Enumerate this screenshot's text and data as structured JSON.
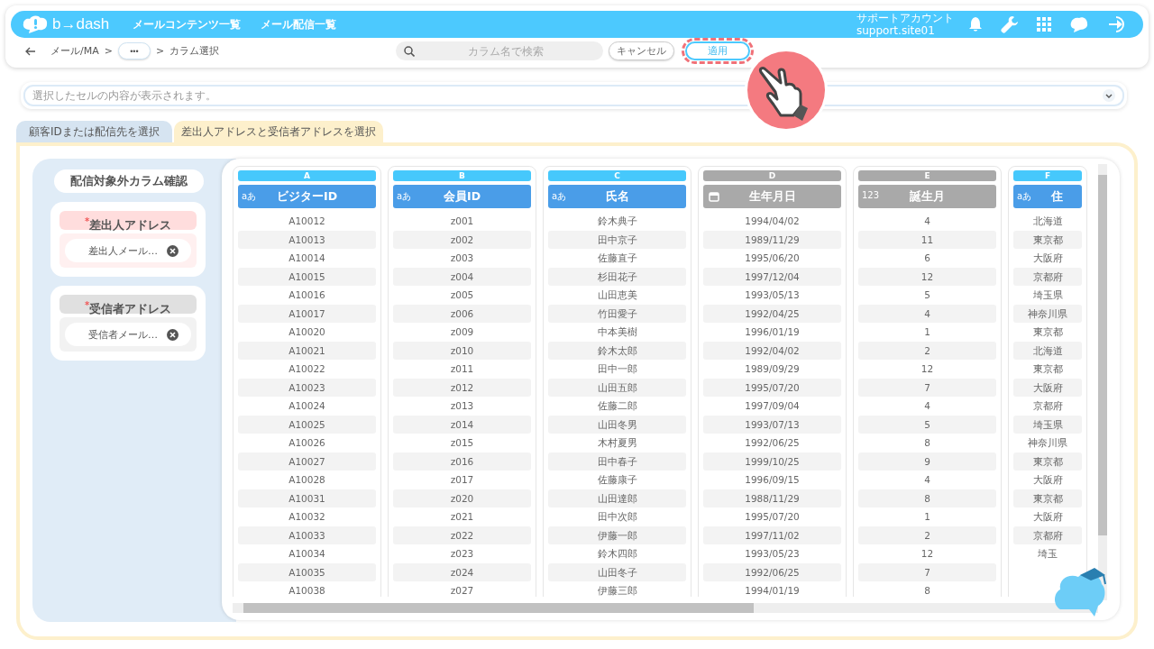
{
  "header": {
    "logo": "b→dash",
    "nav": [
      "メールコンテンツ一覧",
      "メール配信一覧"
    ],
    "account_name": "サポートアカウント",
    "account_id": "support.site01"
  },
  "breadcrumb": {
    "items": [
      "メール/MA",
      "カラム選択"
    ],
    "more": "•••",
    "separator": ">"
  },
  "search": {
    "placeholder": "カラム名で検索"
  },
  "buttons": [
    {
      "label": "キャンセル",
      "kind": "cancel",
      "highlighted": false
    },
    {
      "label": "適用",
      "kind": "apply",
      "highlighted": true
    }
  ],
  "cell_view": {
    "placeholder": "選択したセルの内容が表示されます。"
  },
  "tabs": [
    {
      "label": "顧客IDまたは配信先を選択",
      "selected": false
    },
    {
      "label": "差出人アドレスと受信者アドレスを選択",
      "selected": true
    }
  ],
  "sidebar": {
    "title": "配信対象外カラム確認",
    "groups": [
      {
        "label": "$^{*}$差出人アドレス",
        "active": true,
        "chip": "差出人メール…"
      },
      {
        "label": "$^{*}$受信者アドレス",
        "active": false,
        "chip": "受信者メール…"
      }
    ]
  },
  "table": {
    "columns": [
      {
        "letter": "A",
        "kind": "text",
        "type_mark": "aあ",
        "name": "ビジターID",
        "selected": true,
        "values": [
          "A10012",
          "A10013",
          "A10014",
          "A10015",
          "A10016",
          "A10017",
          "A10020",
          "A10021",
          "A10022",
          "A10023",
          "A10024",
          "A10025",
          "A10026",
          "A10027",
          "A10028",
          "A10031",
          "A10032",
          "A10033",
          "A10034",
          "A10035",
          "A10038"
        ]
      },
      {
        "letter": "B",
        "kind": "text",
        "type_mark": "aあ",
        "name": "会員ID",
        "selected": true,
        "values": [
          "z001",
          "z002",
          "z003",
          "z004",
          "z005",
          "z006",
          "z009",
          "z010",
          "z011",
          "z012",
          "z013",
          "z014",
          "z015",
          "z016",
          "z017",
          "z020",
          "z021",
          "z022",
          "z023",
          "z024",
          "z027"
        ]
      },
      {
        "letter": "C",
        "kind": "text",
        "type_mark": "aあ",
        "name": "氏名",
        "selected": true,
        "values": [
          "鈴木典子",
          "田中京子",
          "佐藤直子",
          "杉田花子",
          "山田恵美",
          "竹田愛子",
          "中本美樹",
          "鈴木太郎",
          "田中一郎",
          "山田五郎",
          "佐藤二郎",
          "山田冬男",
          "木村夏男",
          "田中春子",
          "佐藤康子",
          "山田達郎",
          "田中次郎",
          "伊藤一郎",
          "鈴木四郎",
          "山田冬子",
          "伊藤三郎"
        ]
      },
      {
        "letter": "D",
        "kind": "date",
        "name": "生年月日",
        "selected": false,
        "values": [
          "1994/04/02",
          "1989/11/29",
          "1995/06/20",
          "1997/12/04",
          "1993/05/13",
          "1992/04/25",
          "1996/01/19",
          "1992/04/02",
          "1989/09/29",
          "1995/07/20",
          "1997/09/04",
          "1993/07/13",
          "1992/06/25",
          "1999/10/25",
          "1996/09/15",
          "1988/11/29",
          "1995/07/20",
          "1997/11/02",
          "1993/05/23",
          "1992/06/25",
          "1994/01/19"
        ]
      },
      {
        "letter": "E",
        "kind": "number",
        "type_mark": "123",
        "name": "誕生月",
        "selected": false,
        "values": [
          "4",
          "11",
          "6",
          "12",
          "5",
          "4",
          "1",
          "2",
          "12",
          "7",
          "4",
          "5",
          "8",
          "9",
          "4",
          "8",
          "1",
          "2",
          "12",
          "7",
          "8"
        ]
      },
      {
        "letter": "F",
        "kind": "text",
        "type_mark": "aあ",
        "name": "住",
        "selected": true,
        "values": [
          "北海道",
          "東京都",
          "大阪府",
          "京都府",
          "埼玉県",
          "神奈川県",
          "東京都",
          "北海道",
          "東京都",
          "大阪府",
          "京都府",
          "埼玉県",
          "神奈川県",
          "東京都",
          "大阪府",
          "東京都",
          "大阪府",
          "京都府",
          "埼玉"
        ]
      }
    ]
  }
}
